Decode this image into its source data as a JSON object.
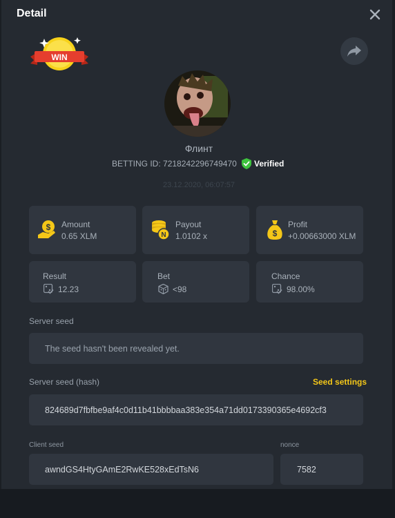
{
  "header": {
    "title": "Detail",
    "close_icon": "close-icon"
  },
  "badge": {
    "text": "WIN"
  },
  "user": {
    "name": "Флинт",
    "betting_id_label": "BETTING ID:",
    "betting_id": "7218242296749470",
    "verified_label": "Verified",
    "timestamp": "23.12.2020, 06:07:57"
  },
  "stats": {
    "amount": {
      "label": "Amount",
      "value": "0.65 XLM",
      "icon": "money-hand-icon"
    },
    "payout": {
      "label": "Payout",
      "value": "1.0102 x",
      "icon": "coins-stack-icon"
    },
    "profit": {
      "label": "Profit",
      "value": "+0.00663000 XLM",
      "icon": "money-bag-icon"
    },
    "result": {
      "label": "Result",
      "value": "12.23",
      "icon": "dice-check-icon"
    },
    "bet": {
      "label": "Bet",
      "value": "<98",
      "icon": "dice-icon"
    },
    "chance": {
      "label": "Chance",
      "value": "98.00%",
      "icon": "dice-check-icon"
    }
  },
  "server_seed": {
    "label": "Server seed",
    "value": "The seed hasn't been revealed yet."
  },
  "server_seed_hash": {
    "label": "Server seed (hash)",
    "settings_link": "Seed settings",
    "value": "824689d7fbfbe9af4c0d11b41bbbbaa383e354a71dd0173390365e4692cf3"
  },
  "client_seed": {
    "label": "Client seed",
    "value": "awndGS4HtyGAmE2RwKE528xEdTsN6"
  },
  "nonce": {
    "label": "nonce",
    "value": "7582"
  },
  "colors": {
    "accent": "#f4c718",
    "verified_green": "#3ec33e",
    "badge_red": "#e53e2e"
  }
}
